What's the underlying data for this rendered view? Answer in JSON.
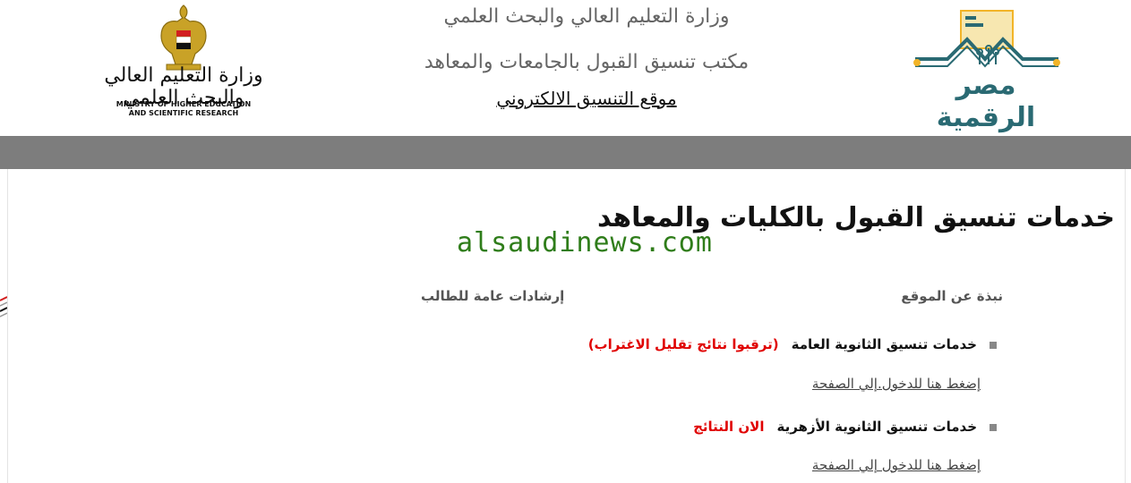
{
  "header": {
    "ministry_line": "وزارة التعليم العالي والبحث العلمي",
    "office_line": "مكتب تنسيق القبول بالجامعات والمعاهد",
    "site_link": "موقع التنسيق الالكتروني",
    "ministry_logo_arabic": "وزارة التعليم العالي والبحث العلمي",
    "ministry_logo_english_1": "MINISTRY OF HIGHER EDUCATION",
    "ministry_logo_english_2": "AND SCIENTIFIC RESEARCH",
    "digital_egypt_logo_text": "مصر الرقمية"
  },
  "main": {
    "title": "خدمات تنسيق القبول بالكليات والمعاهد",
    "watermark": "alsaudinews.com",
    "col_about": "نبذة عن الموقع",
    "col_guidance": "إرشادات عامة للطالب",
    "items": [
      {
        "label": "خدمات تنسيق الثانوية العامة",
        "note": "(ترقبوا نتائج تقليل الاغتراب)",
        "link": "إضغط هنا للدخول.إلي الصفحة"
      },
      {
        "label": "خدمات تنسيق الثانوية الأزهرية",
        "note": "الان النتائج",
        "link": "إضغط هنا للدخول إلي الصفحة"
      }
    ]
  },
  "colors": {
    "gray_bar": "#7d7d7d",
    "accent_red": "#e00000",
    "watermark_green": "#2f7d1a",
    "logo_teal": "#2a6a73",
    "logo_gold": "#f2b428"
  }
}
